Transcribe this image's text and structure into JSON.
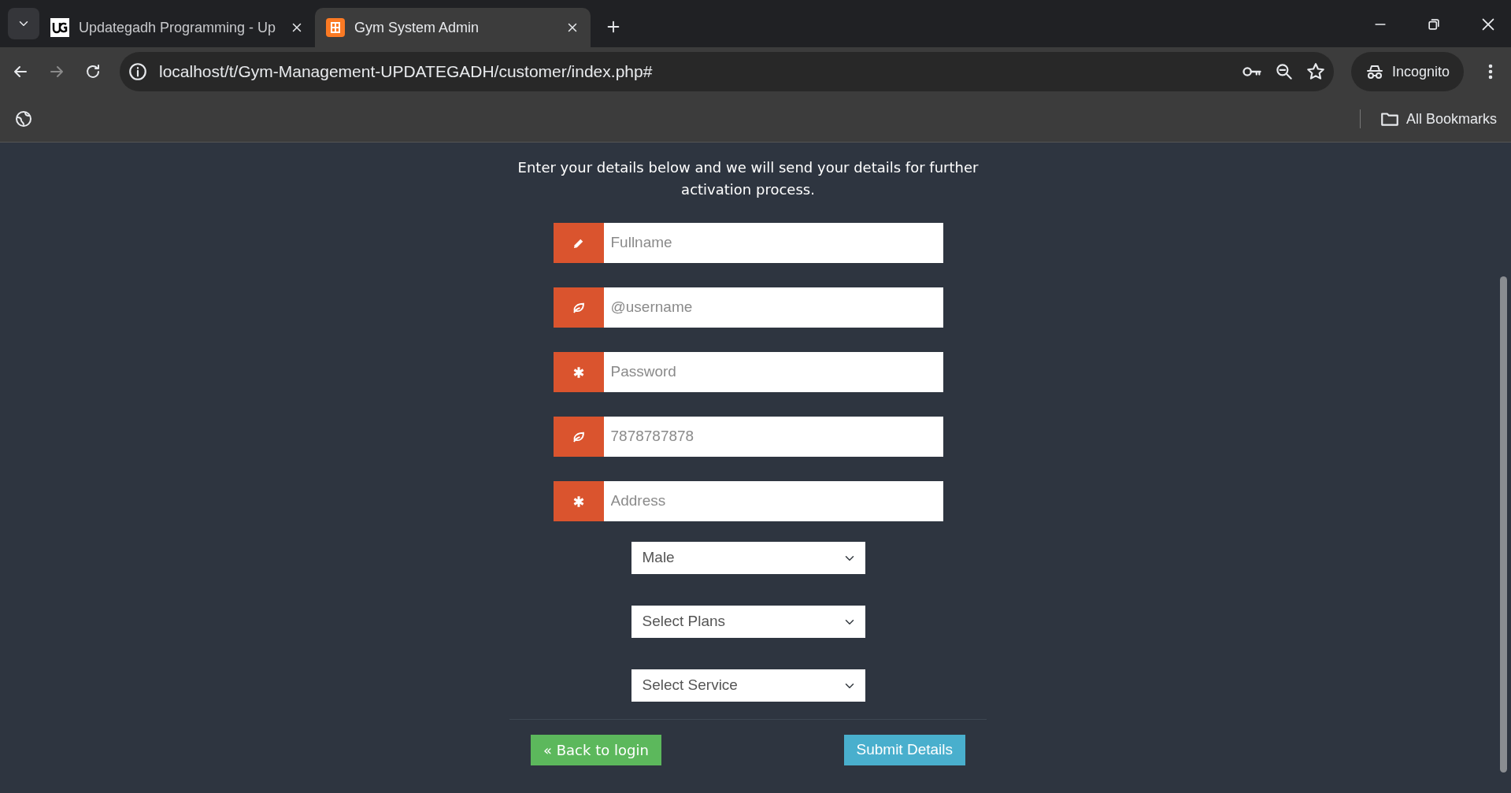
{
  "browser": {
    "tabs": [
      {
        "title": "Updategadh Programming - Up",
        "selected": false
      },
      {
        "title": "Gym System Admin",
        "selected": true
      }
    ],
    "address": "localhost/t/Gym-Management-UPDATEGADH/customer/index.php#",
    "profile": "Incognito",
    "bookmarks_label": "All Bookmarks"
  },
  "form": {
    "intro": "Enter your details below and we will send your details for further activation process.",
    "fields": [
      {
        "placeholder": "Fullname"
      },
      {
        "placeholder": "@username"
      },
      {
        "placeholder": "Password"
      },
      {
        "placeholder": "7878787878"
      },
      {
        "placeholder": "Address"
      }
    ],
    "selects": [
      {
        "value": "Male"
      },
      {
        "value": "Select Plans"
      },
      {
        "value": "Select Service"
      }
    ],
    "back_button": "« Back to login",
    "submit_button": "Submit Details"
  }
}
